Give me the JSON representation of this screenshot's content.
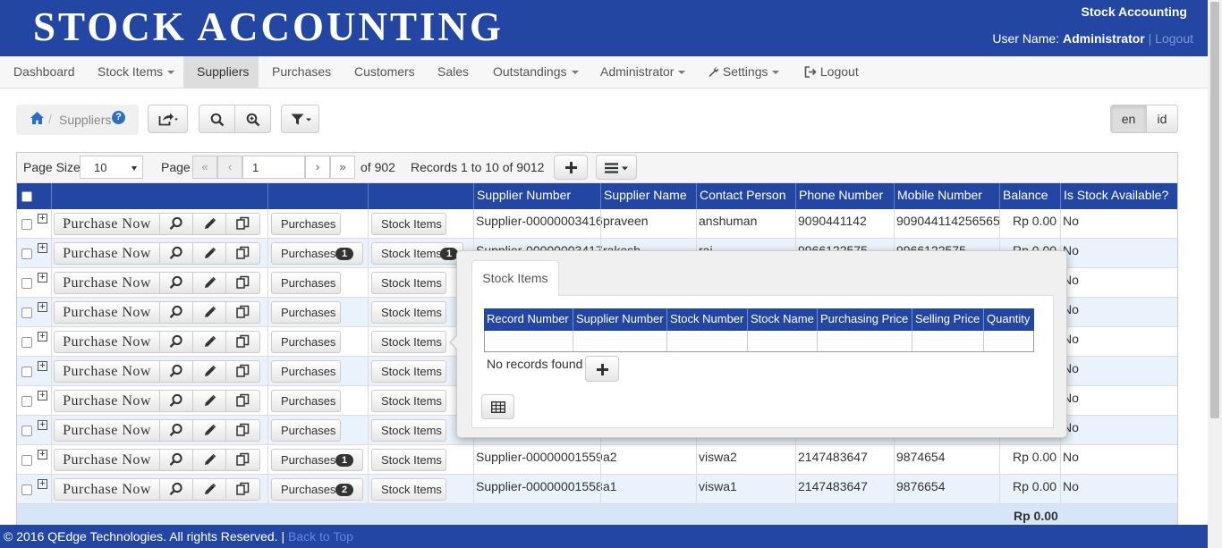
{
  "header": {
    "logo": "STOCK ACCOUNTING",
    "app_name": "Stock Accounting",
    "user_label": "User Name:",
    "user_name": "Administrator",
    "separator": "|",
    "logout_link": "Logout"
  },
  "nav": {
    "items": [
      {
        "label": "Dashboard"
      },
      {
        "label": "Stock Items"
      },
      {
        "label": "Suppliers"
      },
      {
        "label": "Purchases"
      },
      {
        "label": "Customers"
      },
      {
        "label": "Sales"
      },
      {
        "label": "Outstandings"
      },
      {
        "label": "Administrator"
      },
      {
        "label": "Settings"
      },
      {
        "label": "Logout"
      }
    ],
    "active": "Suppliers"
  },
  "breadcrumb": {
    "separator": "/",
    "label": "Suppliers",
    "help": "?"
  },
  "toolbar": {
    "icons": [
      "export-icon",
      "search-icon",
      "zoom-search-icon",
      "filter-icon"
    ]
  },
  "languages": {
    "en": "en",
    "id": "id",
    "active": "en"
  },
  "pager": {
    "page_size_label": "Page Size",
    "page_size": "10",
    "page_label": "Page",
    "page_input": "1",
    "of_pages": "of 902",
    "records_text": "Records 1 to 10 of 9012"
  },
  "table": {
    "columns": [
      "Supplier Number",
      "Supplier Name",
      "Contact Person",
      "Phone Number",
      "Mobile Number",
      "Balance",
      "Is Stock Available?"
    ],
    "purchase_now_label": "Purchase Now",
    "purchases_label": "Purchases",
    "stock_items_label": "Stock Items",
    "rows": [
      {
        "supplier_number": "Supplier-00000003416",
        "supplier_name": "praveen",
        "contact": "anshuman",
        "phone": "9090441142",
        "mobile": "909044114256565",
        "balance": "Rp 0.00",
        "stock": "No",
        "purchases_badge": "",
        "stock_badge": ""
      },
      {
        "supplier_number": "Supplier-00000003417",
        "supplier_name": "rakesh",
        "contact": "raj",
        "phone": "9966122575",
        "mobile": "9966122575",
        "balance": "Rp 0.00",
        "stock": "No",
        "purchases_badge": "1",
        "stock_badge": "1"
      },
      {
        "supplier_number": "",
        "supplier_name": "",
        "contact": "",
        "phone": "",
        "mobile": "",
        "balance": "",
        "stock": "No",
        "purchases_badge": "",
        "stock_badge": ""
      },
      {
        "supplier_number": "",
        "supplier_name": "",
        "contact": "",
        "phone": "",
        "mobile": "",
        "balance": "",
        "stock": "No",
        "purchases_badge": "",
        "stock_badge": ""
      },
      {
        "supplier_number": "",
        "supplier_name": "",
        "contact": "",
        "phone": "",
        "mobile": "",
        "balance": "",
        "stock": "No",
        "purchases_badge": "",
        "stock_badge": ""
      },
      {
        "supplier_number": "",
        "supplier_name": "",
        "contact": "",
        "phone": "",
        "mobile": "",
        "balance": "",
        "stock": "No",
        "purchases_badge": "",
        "stock_badge": ""
      },
      {
        "supplier_number": "",
        "supplier_name": "",
        "contact": "",
        "phone": "",
        "mobile": "",
        "balance": "",
        "stock": "No",
        "purchases_badge": "",
        "stock_badge": ""
      },
      {
        "supplier_number": "",
        "supplier_name": "",
        "contact": "",
        "phone": "",
        "mobile": "",
        "balance": "",
        "stock": "No",
        "purchases_badge": "",
        "stock_badge": ""
      },
      {
        "supplier_number": "Supplier-00000001559",
        "supplier_name": "a2",
        "contact": "viswa2",
        "phone": "2147483647",
        "mobile": "9874654",
        "balance": "Rp 0.00",
        "stock": "No",
        "purchases_badge": "1",
        "stock_badge": ""
      },
      {
        "supplier_number": "Supplier-00000001558",
        "supplier_name": "a1",
        "contact": "viswa1",
        "phone": "2147483647",
        "mobile": "9876654",
        "balance": "Rp 0.00",
        "stock": "No",
        "purchases_badge": "2",
        "stock_badge": ""
      }
    ],
    "total_balance": "Rp 0.00"
  },
  "popup": {
    "tab": "Stock Items",
    "columns": [
      "Record Number",
      "Supplier Number",
      "Stock Number",
      "Stock Name",
      "Purchasing Price",
      "Selling Price",
      "Quantity"
    ],
    "empty_text": "No records found"
  },
  "footer": {
    "copyright": "© 2016 QEdge Technologies. All rights Reserved. |",
    "back_to_top": "Back to Top"
  },
  "colors": {
    "primary": "#2346a3",
    "row_alt": "#eaf2fb",
    "totals": "#d6e6f8"
  }
}
